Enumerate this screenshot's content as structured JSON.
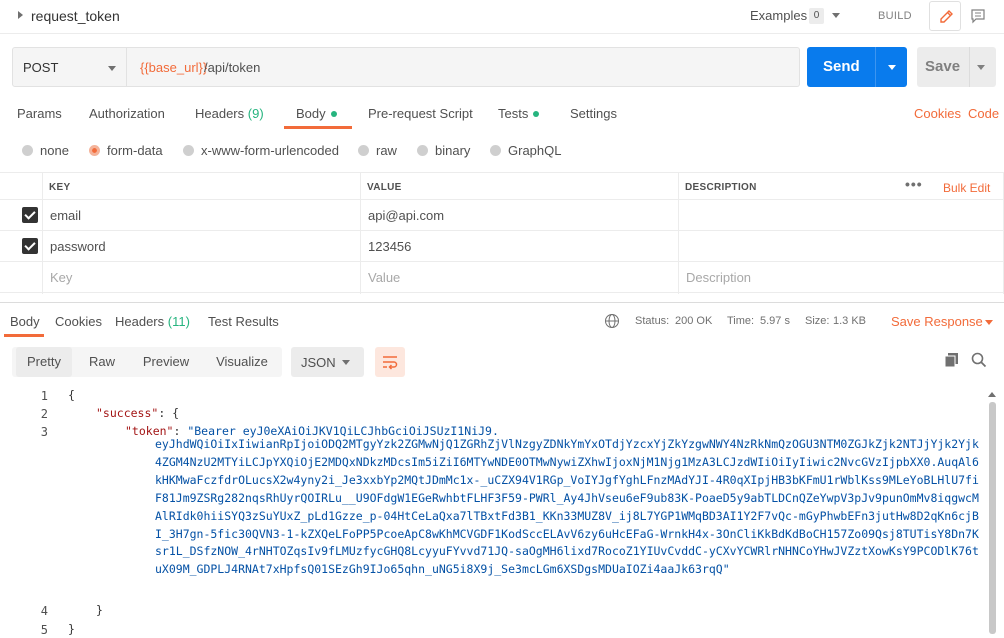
{
  "header": {
    "request_name": "request_token",
    "examples_label": "Examples",
    "examples_count": "0",
    "build_label": "BUILD"
  },
  "request": {
    "method": "POST",
    "url_variable": "{{base_url}}",
    "url_path": "/api/token",
    "send_label": "Send",
    "save_label": "Save"
  },
  "tabs": [
    {
      "label": "Params"
    },
    {
      "label": "Authorization"
    },
    {
      "label": "Headers",
      "count": "(9)"
    },
    {
      "label": "Body",
      "dot": true
    },
    {
      "label": "Pre-request Script"
    },
    {
      "label": "Tests",
      "dot": true
    },
    {
      "label": "Settings"
    }
  ],
  "links": {
    "cookies": "Cookies",
    "code": "Code"
  },
  "body_types": [
    "none",
    "form-data",
    "x-www-form-urlencoded",
    "raw",
    "binary",
    "GraphQL"
  ],
  "selected_body_type": "form-data",
  "table": {
    "headers": {
      "key": "KEY",
      "value": "VALUE",
      "description": "DESCRIPTION"
    },
    "more": "•••",
    "bulk_edit": "Bulk Edit",
    "rows": [
      {
        "checked": true,
        "key": "email",
        "value": "api@api.com",
        "description": ""
      },
      {
        "checked": true,
        "key": "password",
        "value": "123456",
        "description": ""
      }
    ],
    "placeholders": {
      "key": "Key",
      "value": "Value",
      "description": "Description"
    }
  },
  "response": {
    "tabs": [
      {
        "label": "Body"
      },
      {
        "label": "Cookies"
      },
      {
        "label": "Headers",
        "count": "(11)"
      },
      {
        "label": "Test Results"
      }
    ],
    "status_label": "Status:",
    "status_value": "200 OK",
    "time_label": "Time:",
    "time_value": "5.97 s",
    "size_label": "Size:",
    "size_value": "1.3 KB",
    "save_response": "Save Response",
    "view_tabs": [
      "Pretty",
      "Raw",
      "Preview",
      "Visualize"
    ],
    "format": "JSON",
    "code": {
      "line_numbers": [
        "1",
        "2",
        "3",
        "4",
        "5"
      ],
      "open_brace": "{",
      "success_key": "\"success\"",
      "success_open": ": {",
      "token_key": "\"token\"",
      "token_colon": ": ",
      "token_first": "\"Bearer eyJ0eXAiOiJKV1QiLCJhbGciOiJSUzI1NiJ9.",
      "token_rest": "eyJhdWQiOiIxIiwianRpIjoiODQ2MTgyYzk2ZGMwNjQ1ZGRhZjVlNzgyZDNkYmYxOTdjYzcxYjZkYzgwNWY4NzRkNmQzOGU3NTM0ZGJkZjk2NTJjYjk2Yjk4ZGM4NzU2MTYiLCJpYXQiOjE2MDQxNDkzMDcsIm5iZiI6MTYwNDE0OTMwNywiZXhwIjoxNjM1Njg1MzA3LCJzdWIiOiIyIiwic2NvcGVzIjpbXX0.AuqAl6kHKMwaFczfdrOLucsX2w4yny2i_Je3xxbYp2MQtJDmMc1x-_uCZX94V1RGp_VoIYJgfYghLFnzMAdYJI-4R0qXIpjHB3bKFmU1rWblKss9MLeYoBLHlU7fiF81Jm9ZSRg282nqsRhUyrQOIRLu__U9OFdgW1EGeRwhbtFLHF3F59-PWRl_Ay4JhVseu6eF9ub83K-PoaeD5y9abTLDCnQZeYwpV3pJv9punOmMv8iqgwcMAlRIdk0hiiSYQ3zSuYUxZ_pLd1Gzze_p-04HtCeLaQxa7lTBxtFd3B1_KKn33MUZ8V_ij8L7YGP1WMqBD3AI1Y2F7vQc-mGyPhwbEFn3jutHw8D2qKn6cjBI_3H7gn-5fic30QVN3-1-kZXQeLFoPP5PcoeApC8wKhMCVGDF1KodSccELAvV6zy6uHcEFaG-WrnkH4x-3OnCliKkBdKdBoCH157Zo09Qsj8TUTisY8Dn7Ksr1L_DSfzNOW_4rNHTOZqsIv9fLMUzfycGHQ8LcyyuFYvvd71JQ-saOgMH6lixd7RocoZ1YIUvCvddC-yCXvYCWRlrNHNCoYHwJVZztXowKsY9PCODlK76tuX09M_GDPLJ4RNAt7xHpfsQ01SEzGh9IJo65qhn_uNG5i8X9j_Se3mcLGm6XSDgsMDUaIOZi4aaJk63rqQ\"",
      "close_inner": "}",
      "close_outer": "}"
    }
  },
  "colors": {
    "accent": "#f26b3a",
    "primary": "#097bed",
    "success": "#26b47f"
  }
}
